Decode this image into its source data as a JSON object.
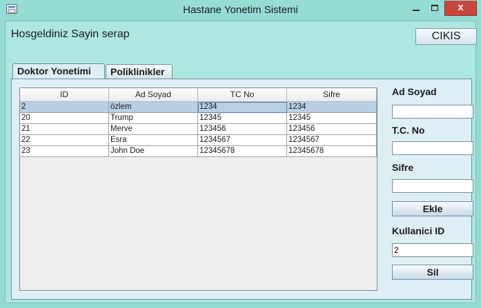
{
  "window": {
    "title": "Hastane Yonetim Sistemi",
    "icon": "app-window-icon",
    "controls": {
      "minimize": "minimize-icon",
      "maximize": "maximize-icon",
      "close": "x"
    }
  },
  "header": {
    "welcome": "Hosgeldiniz Sayin serap",
    "exit_label": "CIKIS"
  },
  "tabs": [
    {
      "label": "Doktor Yonetimi",
      "active": true
    },
    {
      "label": "Poliklinikler",
      "active": false
    }
  ],
  "table": {
    "columns": [
      "ID",
      "Ad Soyad",
      "TC No",
      "Sifre"
    ],
    "rows": [
      [
        "2",
        "özlem",
        "1234",
        "1234"
      ],
      [
        "20",
        "Trump",
        "12345",
        "12345"
      ],
      [
        "21",
        "Merve",
        "123456",
        "123456"
      ],
      [
        "22",
        "Esra",
        "1234567",
        "1234567"
      ],
      [
        "23",
        "John Doe",
        "12345678",
        "12345678"
      ]
    ],
    "selected_row": 0
  },
  "form": {
    "ad_soyad_label": "Ad Soyad",
    "ad_soyad_value": "",
    "tc_label": "T.C. No",
    "tc_value": "",
    "sifre_label": "Sifre",
    "sifre_value": "",
    "ekle_label": "Ekle",
    "kullanici_id_label": "Kullanici ID",
    "kullanici_id_value": "2",
    "sil_label": "Sil"
  },
  "colors": {
    "window_frame": "#93dbd3",
    "client_bg": "#ade7df",
    "panel_bg": "#ddeef5",
    "selection": "#b8cfe5",
    "close_button": "#c7473f"
  }
}
